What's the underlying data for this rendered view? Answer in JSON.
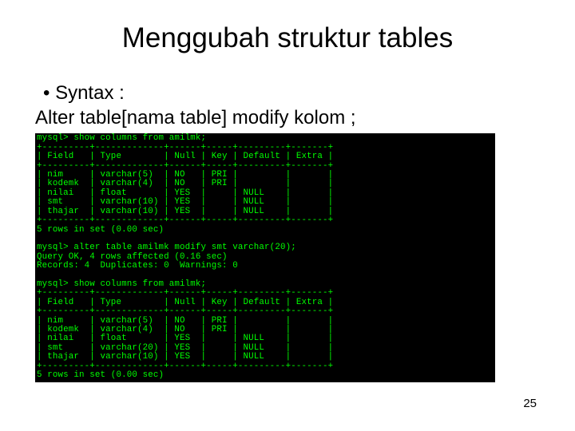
{
  "title": "Menggubah struktur tables",
  "bullet_label": "Syntax :",
  "syntax_line": "Alter table[nama table] modify kolom ;",
  "page_number": "25",
  "terminal": {
    "prompt1": "mysql> show columns from amilmk;",
    "hline": "+---------+-------------+------+-----+---------+-------+",
    "header_row": "| Field   | Type        | Null | Key | Default | Extra |",
    "rows1": [
      "| nim     | varchar(5)  | NO   | PRI |         |       |",
      "| kodemk  | varchar(4)  | NO   | PRI |         |       |",
      "| nilai   | float       | YES  |     | NULL    |       |",
      "| smt     | varchar(10) | YES  |     | NULL    |       |",
      "| thajar  | varchar(10) | YES  |     | NULL    |       |"
    ],
    "footer1": "5 rows in set (0.00 sec)",
    "alter_cmd": "mysql> alter table amilmk modify smt varchar(20);",
    "alter_out1": "Query OK, 4 rows affected (0.16 sec)",
    "alter_out2": "Records: 4  Duplicates: 0  Warnings: 0",
    "prompt2": "mysql> show columns from amilmk;",
    "rows2": [
      "| nim     | varchar(5)  | NO   | PRI |         |       |",
      "| kodemk  | varchar(4)  | NO   | PRI |         |       |",
      "| nilai   | float       | YES  |     | NULL    |       |",
      "| smt     | varchar(20) | YES  |     | NULL    |       |",
      "| thajar  | varchar(10) | YES  |     | NULL    |       |"
    ],
    "footer2": "5 rows in set (0.00 sec)"
  }
}
